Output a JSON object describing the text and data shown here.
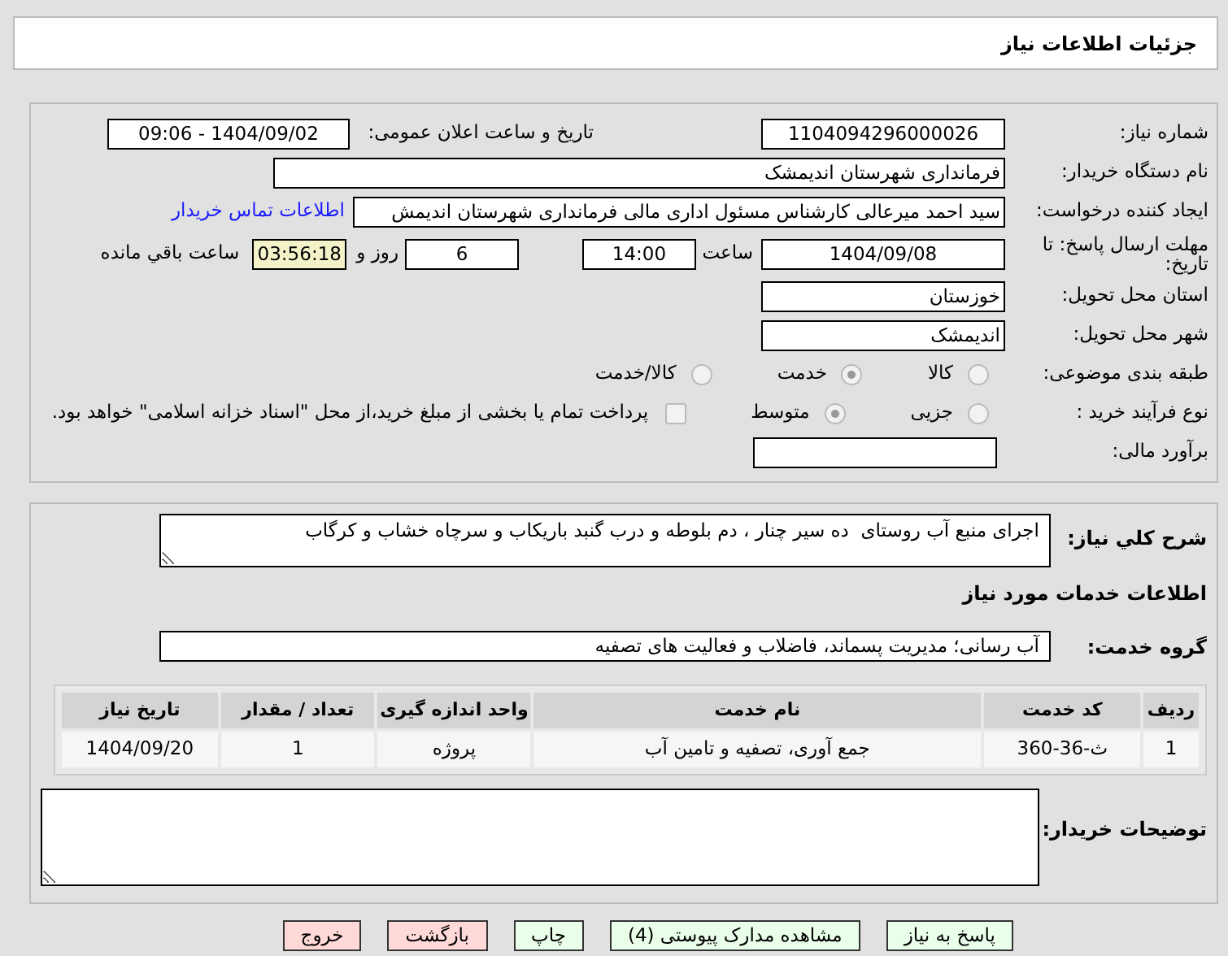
{
  "page_title": "جزئیات اطلاعات نیاز",
  "need_number": {
    "label": "شماره نیاز:",
    "value": "1104094296000026"
  },
  "announce": {
    "label": "تاریخ و ساعت اعلان عمومی:",
    "value": "1404/09/02 - 09:06"
  },
  "buyer_org": {
    "label": "نام دستگاه خریدار:",
    "value": "فرمانداری شهرستان اندیمشک"
  },
  "requester": {
    "label": "ایجاد کننده درخواست:",
    "value": "سید احمد میرعالی کارشناس مسئول اداری مالی فرمانداری شهرستان اندیمش",
    "link": "اطلاعات تماس خریدار"
  },
  "deadline": {
    "label": "مهلت ارسال پاسخ: تا تاریخ:",
    "date": "1404/09/08",
    "time_label": "ساعت",
    "time": "14:00",
    "days": "6",
    "days_label": "روز و",
    "remaining": "03:56:18",
    "remaining_label": "ساعت باقي مانده"
  },
  "province": {
    "label": "استان محل تحویل:",
    "value": "خوزستان"
  },
  "city": {
    "label": "شهر محل تحویل:",
    "value": "اندیمشک"
  },
  "category": {
    "label": "طبقه بندی موضوعی:",
    "options": [
      {
        "label": "کالا",
        "selected": false
      },
      {
        "label": "خدمت",
        "selected": true
      },
      {
        "label": "کالا/خدمت",
        "selected": false
      }
    ]
  },
  "process": {
    "label": "نوع فرآیند خرید :",
    "options": [
      {
        "label": "جزیی",
        "selected": false
      },
      {
        "label": "متوسط",
        "selected": true
      }
    ],
    "checkbox": {
      "label": "پرداخت تمام یا بخشی از مبلغ خرید،از محل \"اسناد خزانه اسلامی\" خواهد بود.",
      "checked": false
    }
  },
  "budget": {
    "label": "برآورد مالی:"
  },
  "description": {
    "label": "شرح کلي نیاز:",
    "value": "اجرای منبع آب روستای  ده سیر چنار ، دم بلوطه و درب گنبد باریکاب و سرچاه خشاب و کرگاب"
  },
  "services_heading": "اطلاعات خدمات مورد نیاز",
  "service_group": {
    "label": "گروه خدمت:",
    "value": "آب رسانی؛ مدیریت پسماند، فاضلاب و فعالیت های تصفیه"
  },
  "table": {
    "columns": [
      "ردیف",
      "کد خدمت",
      "نام خدمت",
      "واحد اندازه گیری",
      "تعداد / مقدار",
      "تاریخ نیاز"
    ],
    "rows": [
      [
        "1",
        "ث-36-360",
        "جمع آوری، تصفیه و تامین آب",
        "پروژه",
        "1",
        "1404/09/20"
      ]
    ]
  },
  "buyer_notes": {
    "label": "توضیحات خریدار:"
  },
  "buttons": [
    {
      "label": "پاسخ به نیاز",
      "kind": "green"
    },
    {
      "label": "مشاهده مدارک پیوستی (4)",
      "kind": "green"
    },
    {
      "label": "چاپ",
      "kind": "green"
    },
    {
      "label": "بازگشت",
      "kind": "red"
    },
    {
      "label": "خروج",
      "kind": "red"
    }
  ]
}
